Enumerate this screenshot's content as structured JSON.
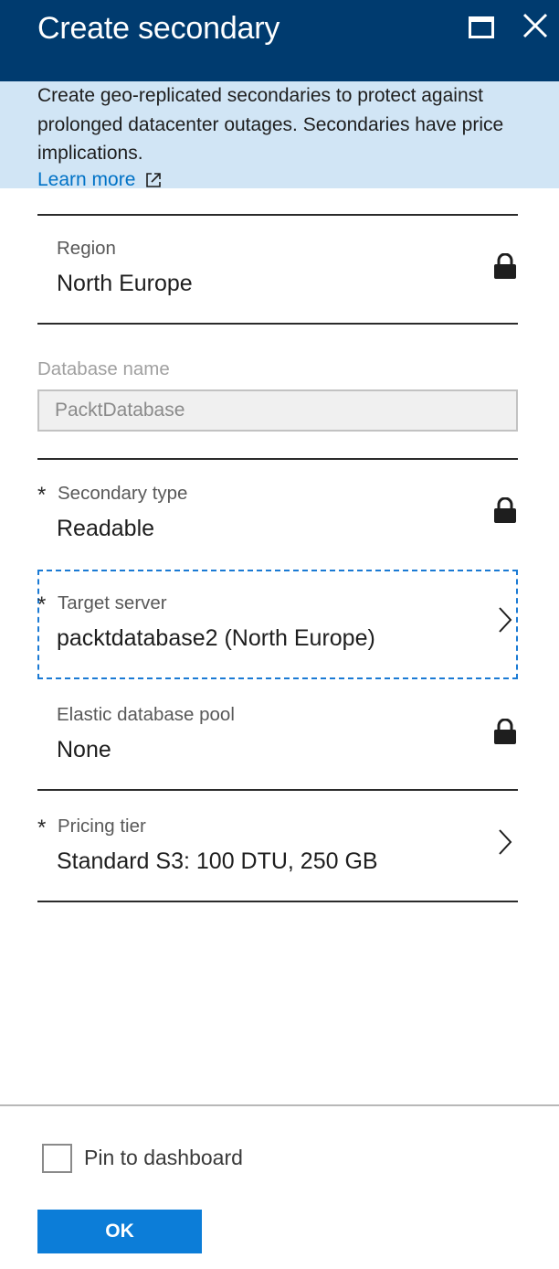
{
  "header": {
    "title": "Create secondary",
    "background": "#003b6f"
  },
  "info": {
    "text": "Create geo-replicated secondaries to protect against prolonged datacenter outages. Secondaries have price implications.",
    "learn_more": "Learn more",
    "background": "#d1e5f5"
  },
  "region": {
    "label": "Region",
    "value": "North Europe",
    "icon": "lock-icon"
  },
  "database_name": {
    "label": "Database name",
    "value": "PacktDatabase"
  },
  "secondary_type": {
    "required": "*",
    "label": "Secondary type",
    "value": "Readable",
    "icon": "lock-icon"
  },
  "target_server": {
    "required": "*",
    "label": "Target server",
    "value": "packtdatabase2 (North Europe)",
    "icon": "chevron-right-icon"
  },
  "elastic_pool": {
    "label": "Elastic database pool",
    "value": "None",
    "icon": "lock-icon"
  },
  "pricing_tier": {
    "required": "*",
    "label": "Pricing tier",
    "value": "Standard S3: 100 DTU, 250 GB",
    "icon": "chevron-right-icon"
  },
  "footer": {
    "pin_label": "Pin to dashboard",
    "pin_checked": false,
    "ok_label": "OK",
    "ok_color": "#0c7dd8"
  }
}
